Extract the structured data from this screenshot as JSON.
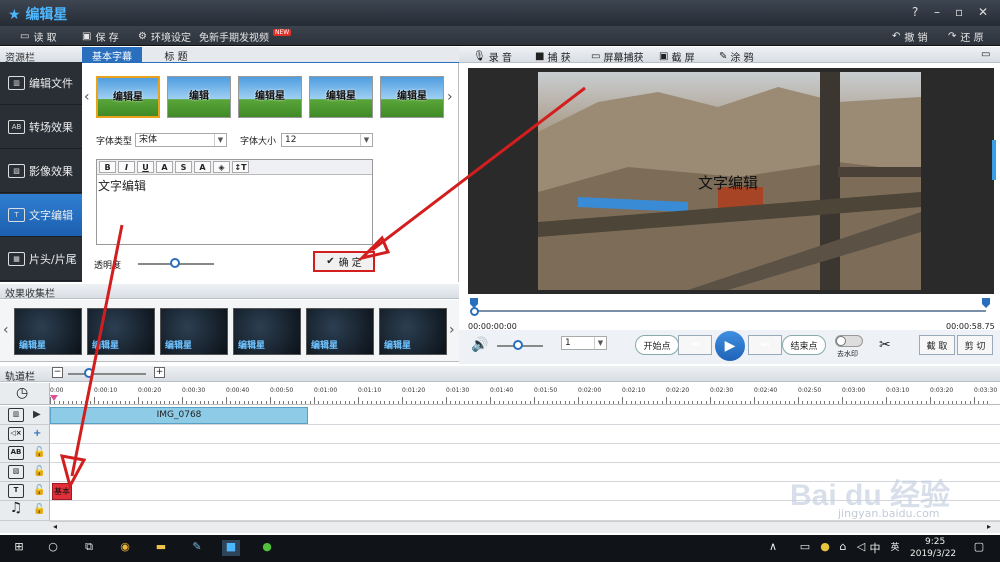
{
  "app": {
    "title": "编辑星",
    "help": "?",
    "win_min": "–",
    "win_max": "▫",
    "win_close": "✕"
  },
  "menu": {
    "read": "读 取",
    "save": "保 存",
    "env": "环境设定",
    "tutorial": "免新手期发视频",
    "new_badge": "NEW",
    "undo": "撤 销",
    "redo": "还 原"
  },
  "resources": {
    "header": "资源栏",
    "items": [
      {
        "label": "编辑文件",
        "icon": "film-icon"
      },
      {
        "label": "转场效果",
        "icon": "ab-transition-icon"
      },
      {
        "label": "影像效果",
        "icon": "image-effect-icon"
      },
      {
        "label": "文字编辑",
        "icon": "text-icon"
      },
      {
        "label": "片头/片尾",
        "icon": "title-sequence-icon"
      }
    ]
  },
  "subtitle_panel": {
    "tabs": [
      "基本字幕",
      "标 题"
    ],
    "presets": [
      "编辑星",
      "编辑",
      "编辑星",
      "编辑星",
      "编辑星"
    ],
    "font_type_label": "字体类型",
    "font_type_value": "宋体",
    "font_size_label": "字体大小",
    "font_size_value": "12",
    "toolbar": [
      "B",
      "I",
      "U",
      "A",
      "S",
      "A",
      "◈",
      "↕T"
    ],
    "text": "文字编辑",
    "opacity_label": "透明度",
    "opacity_value": 0.35,
    "confirm": "确 定"
  },
  "effects": {
    "header": "效果收集栏",
    "thumb_label": "编辑星",
    "count": 6
  },
  "preview_toolbar": {
    "record": "录 音",
    "capture": "捕 获",
    "screen_capture": "屏幕捕获",
    "screenshot": "截 屏",
    "doodle": "涂 鸦"
  },
  "preview": {
    "overlay_text": "文字编辑",
    "time_start": "00:00:00:00",
    "time_end": "00:00:58.75",
    "progress": 0.0
  },
  "controls": {
    "volume": 0.5,
    "speed_value": "1",
    "start_point": "开始点",
    "end_point": "结束点",
    "watermark": "去水印",
    "cut": "截 取",
    "split": "剪 切"
  },
  "timeline": {
    "header": "轨道栏",
    "ticks": [
      "0:00",
      "0:00:10",
      "0:00:20",
      "0:00:30",
      "0:00:40",
      "0:00:50",
      "0:01:00",
      "0:01:10",
      "0:01:20",
      "0:01:30",
      "0:01:40",
      "0:01:50",
      "0:02:00",
      "0:02:10",
      "0:02:20",
      "0:02:30",
      "0:02:40",
      "0:02:50",
      "0:03:00",
      "0:03:10",
      "0:03:20",
      "0:03:30"
    ],
    "video_clip": "IMG_0768",
    "text_clip": "基本",
    "zoom_minus": "−",
    "zoom_plus": "+",
    "track_icons": [
      "film-icon",
      "mute-icon",
      "ab-transition-icon",
      "image-effect-icon",
      "text-icon",
      "music-icon"
    ],
    "add_symbol": "+"
  },
  "taskbar": {
    "time": "9:25",
    "date": "2019/3/22",
    "ime": "中",
    "ime2": "英"
  },
  "watermark": {
    "brand": "Bai du 经验",
    "url": "jingyan.baidu.com"
  }
}
